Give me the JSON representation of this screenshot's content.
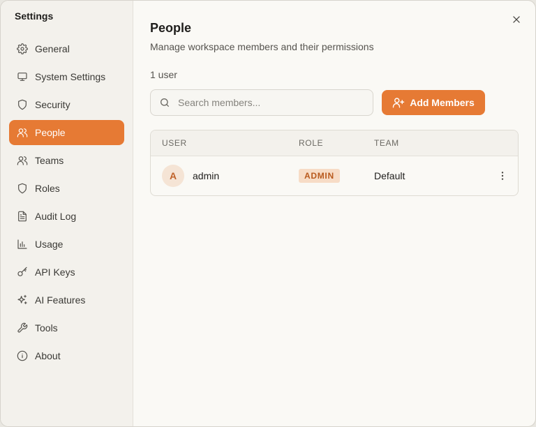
{
  "sidebar": {
    "title": "Settings",
    "items": [
      {
        "label": "General",
        "icon": "gear-icon"
      },
      {
        "label": "System Settings",
        "icon": "monitor-icon"
      },
      {
        "label": "Security",
        "icon": "shield-icon"
      },
      {
        "label": "People",
        "icon": "users-icon",
        "active": true
      },
      {
        "label": "Teams",
        "icon": "users-icon"
      },
      {
        "label": "Roles",
        "icon": "shield-icon"
      },
      {
        "label": "Audit Log",
        "icon": "document-icon"
      },
      {
        "label": "Usage",
        "icon": "bar-chart-icon"
      },
      {
        "label": "API Keys",
        "icon": "key-icon"
      },
      {
        "label": "AI Features",
        "icon": "sparkle-icon"
      },
      {
        "label": "Tools",
        "icon": "wrench-icon"
      },
      {
        "label": "About",
        "icon": "info-icon"
      }
    ]
  },
  "main": {
    "title": "People",
    "subtitle": "Manage workspace members and their permissions",
    "user_count": "1 user",
    "search": {
      "placeholder": "Search members...",
      "value": ""
    },
    "add_button": "Add Members",
    "table": {
      "columns": [
        "USER",
        "ROLE",
        "TEAM"
      ],
      "rows": [
        {
          "avatar_initial": "A",
          "user": "admin",
          "role": "ADMIN",
          "team": "Default"
        }
      ]
    }
  },
  "colors": {
    "accent": "#e67a34",
    "badge_bg": "#f7dcc6",
    "badge_text": "#b85a1e"
  }
}
